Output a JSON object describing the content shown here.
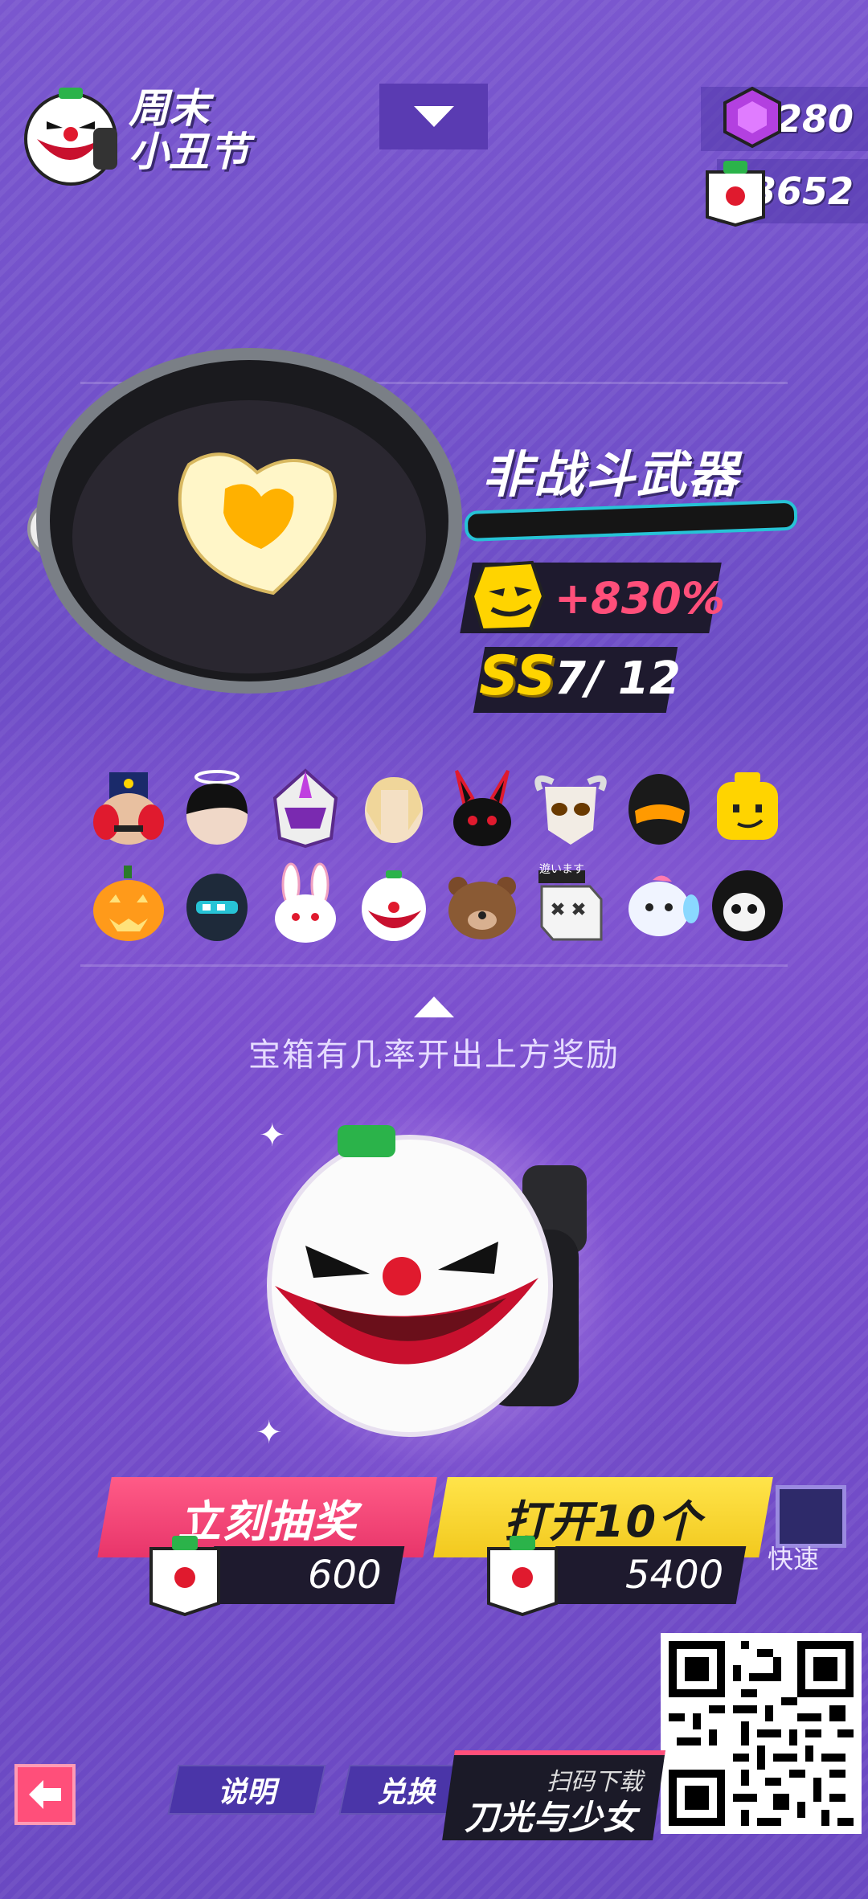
{
  "event": {
    "title_line1": "周末",
    "title_line2": "小丑节",
    "icon": "clown-crate-icon"
  },
  "currency": [
    {
      "icon": "purple-gem-icon",
      "value": "280"
    },
    {
      "icon": "clown-box-token-icon",
      "value": "3652"
    }
  ],
  "weapon": {
    "name": "非战斗武器",
    "image": "frying-pan-heart-egg",
    "bonus": "+830%",
    "bonus_icon": "smug-face-icon",
    "rank_grade": "SS",
    "rank_count": "7/ 12"
  },
  "rewards": [
    {
      "icon": "nutcracker-head-icon"
    },
    {
      "icon": "black-hair-halo-icon"
    },
    {
      "icon": "purple-helmet-icon"
    },
    {
      "icon": "blonde-hair-icon"
    },
    {
      "icon": "black-bunny-icon"
    },
    {
      "icon": "horned-skull-icon"
    },
    {
      "icon": "black-visor-helmet-icon"
    },
    {
      "icon": "yellow-block-head-icon"
    },
    {
      "icon": "pumpkin-head-icon"
    },
    {
      "icon": "knight-helmet-icon"
    },
    {
      "icon": "white-bunny-icon"
    },
    {
      "icon": "clown-mask-icon"
    },
    {
      "icon": "brown-bear-icon"
    },
    {
      "icon": "box-head-icon",
      "tag": "遊います"
    },
    {
      "icon": "fish-head-icon"
    },
    {
      "icon": "hooded-skull-icon"
    }
  ],
  "hint": "宝箱有几率开出上方奖励",
  "crate_image": "clown-crate",
  "actions": {
    "draw_label": "立刻抽奖",
    "draw_cost": "600",
    "open_label": "打开10个",
    "open_cost": "5400",
    "fast_label": "快速"
  },
  "bottom": {
    "info_label": "说明",
    "exchange_label": "兑换",
    "promo_small": "扫码下载",
    "promo_big": "刀光与少女"
  },
  "colors": {
    "accent_pink": "#ff4f7a",
    "accent_yellow": "#ffd400",
    "panel_dark": "#1e1a2e"
  }
}
